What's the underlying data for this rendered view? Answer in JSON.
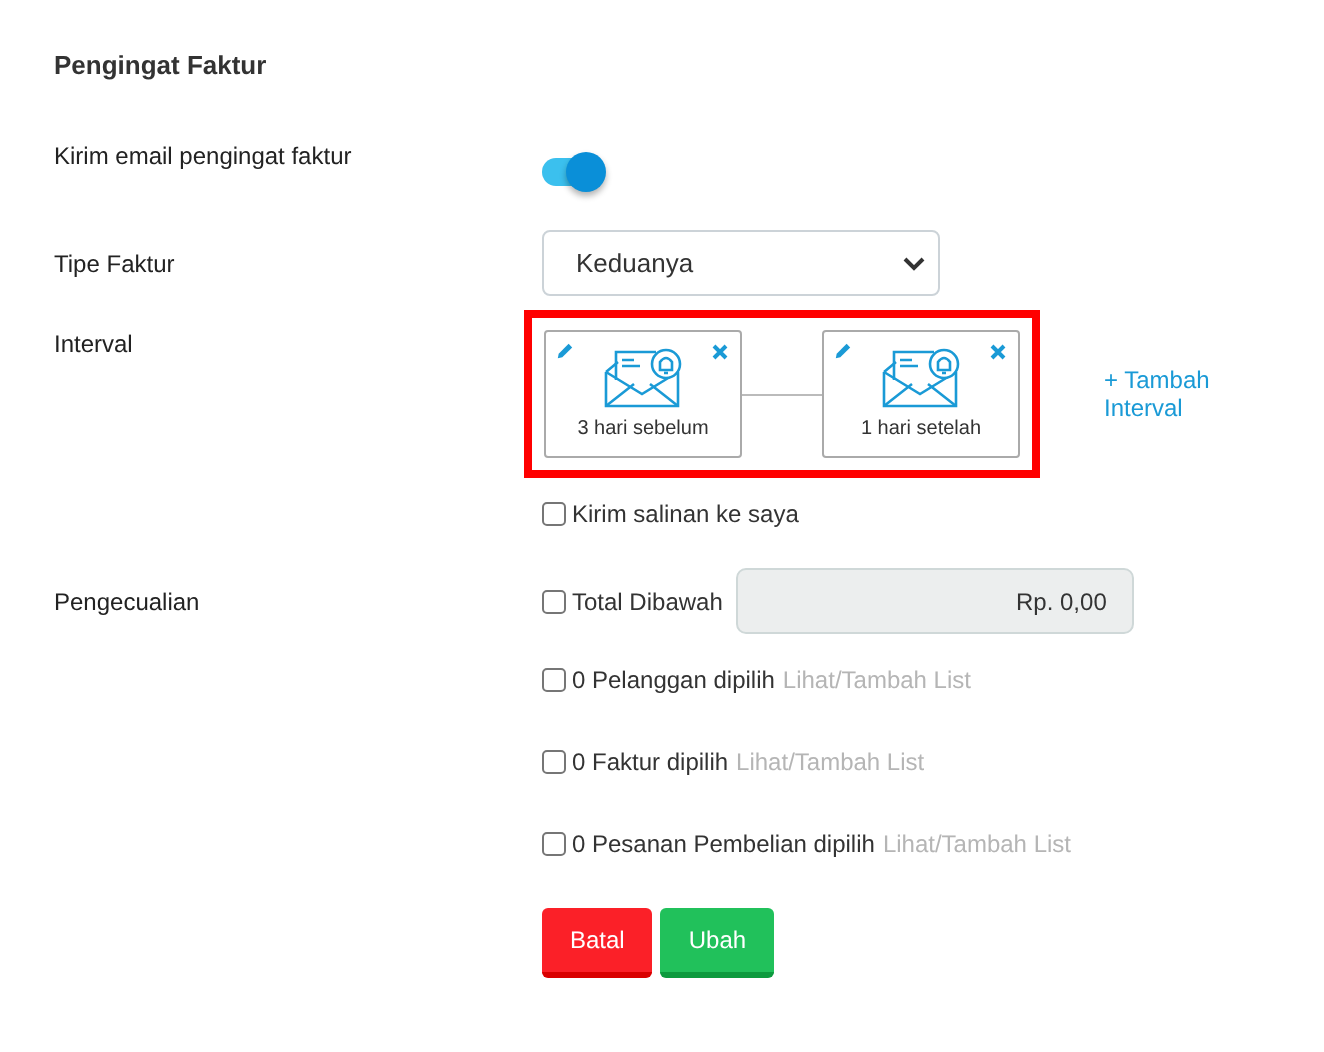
{
  "title": "Pengingat Faktur",
  "send_email": {
    "label": "Kirim email pengingat faktur",
    "on": true
  },
  "invoice_type": {
    "label": "Tipe Faktur",
    "value": "Keduanya"
  },
  "interval": {
    "label": "Interval",
    "highlighted": true,
    "items": [
      {
        "text": "3 hari sebelum"
      },
      {
        "text": "1 hari setelah"
      }
    ],
    "add_link": "+ Tambah Interval"
  },
  "send_copy": {
    "label": "Kirim salinan ke saya",
    "checked": false
  },
  "exceptions": {
    "label": "Pengecualian",
    "total": {
      "label": "Total Dibawah",
      "checked": false,
      "value": "Rp. 0,00"
    },
    "lists": [
      {
        "label": "0 Pelanggan dipilih",
        "link": "Lihat/Tambah List",
        "checked": false
      },
      {
        "label": "0 Faktur dipilih",
        "link": "Lihat/Tambah List",
        "checked": false
      },
      {
        "label": "0 Pesanan Pembelian dipilih",
        "link": "Lihat/Tambah List",
        "checked": false
      }
    ]
  },
  "buttons": [
    {
      "label": "Batal",
      "kind": "cancel"
    },
    {
      "label": "Ubah",
      "kind": "save"
    }
  ]
}
